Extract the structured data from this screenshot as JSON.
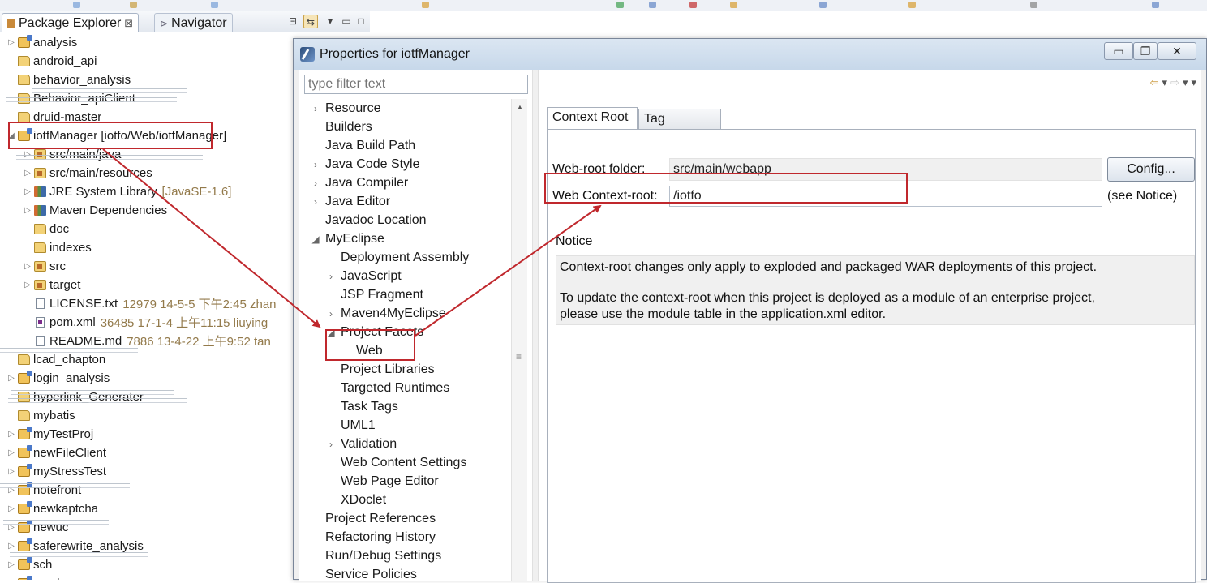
{
  "explorer": {
    "tab_package_explorer": "Package Explorer",
    "tab_navigator": "Navigator",
    "tree": [
      {
        "label": "analysis",
        "icon": "project-icon",
        "expander": "▷"
      },
      {
        "label": "android_api",
        "icon": "folder-icon",
        "expander": ""
      },
      {
        "label": "behavior_analysis",
        "icon": "folder-icon",
        "expander": ""
      },
      {
        "label": "Behavior_apiClient",
        "icon": "folder-icon",
        "expander": ""
      },
      {
        "label": "druid-master",
        "icon": "folder-icon",
        "expander": ""
      },
      {
        "label": "iotfManager [iotfo/Web/iotfManager]",
        "icon": "project-icon",
        "expander": "◢"
      },
      {
        "label": "src/main/java",
        "icon": "package-folder-icon",
        "expander": "▷"
      },
      {
        "label": "src/main/resources",
        "icon": "package-folder-icon",
        "expander": "▷"
      },
      {
        "label": "JRE System Library",
        "decoration": "[JavaSE-1.6]",
        "icon": "library-icon",
        "expander": "▷"
      },
      {
        "label": "Maven Dependencies",
        "icon": "library-icon",
        "expander": "▷"
      },
      {
        "label": "doc",
        "icon": "folder-icon",
        "expander": ""
      },
      {
        "label": "indexes",
        "icon": "folder-icon",
        "expander": ""
      },
      {
        "label": "src",
        "icon": "package-folder-icon",
        "expander": "▷"
      },
      {
        "label": "target",
        "icon": "package-folder-icon",
        "expander": "▷"
      },
      {
        "label": "LICENSE.txt",
        "decoration": "12979  14-5-5 下午2:45  zhan",
        "icon": "file-icon",
        "expander": ""
      },
      {
        "label": "pom.xml",
        "decoration": "36485  17-1-4 上午11:15  liuying",
        "icon": "xml-file-icon",
        "expander": ""
      },
      {
        "label": "README.md",
        "decoration": "7886  13-4-22 上午9:52  tan",
        "icon": "file-icon",
        "expander": ""
      },
      {
        "label": "lcad_chapton",
        "icon": "folder-icon",
        "expander": ""
      },
      {
        "label": "login_analysis",
        "icon": "project-icon",
        "expander": "▷"
      },
      {
        "label": "hyperlink_Generater",
        "icon": "folder-icon",
        "expander": ""
      },
      {
        "label": "mybatis",
        "icon": "folder-icon",
        "expander": ""
      },
      {
        "label": "myTestProj",
        "icon": "project-icon",
        "expander": "▷"
      },
      {
        "label": "newFileClient",
        "icon": "project-icon",
        "expander": "▷"
      },
      {
        "label": "myStressTest",
        "icon": "project-icon",
        "expander": "▷"
      },
      {
        "label": "notefront",
        "icon": "project-icon",
        "expander": "▷"
      },
      {
        "label": "newkaptcha",
        "icon": "project-icon",
        "expander": "▷"
      },
      {
        "label": "newuc",
        "icon": "project-icon",
        "expander": "▷"
      },
      {
        "label": "saferewrite_analysis",
        "icon": "project-icon",
        "expander": "▷"
      },
      {
        "label": "sch",
        "icon": "project-icon",
        "expander": "▷"
      },
      {
        "label": "sendsms",
        "icon": "project-icon",
        "expander": "▷"
      }
    ]
  },
  "dialog": {
    "title": "Properties for iotfManager",
    "window_buttons": {
      "minimize": "▭",
      "maximize": "❐",
      "close": "✕"
    },
    "filter_placeholder": "type filter text",
    "nav": [
      {
        "label": "Resource",
        "expander": "›",
        "level": 0
      },
      {
        "label": "Builders",
        "expander": "",
        "level": 0
      },
      {
        "label": "Java Build Path",
        "expander": "",
        "level": 0
      },
      {
        "label": "Java Code Style",
        "expander": "›",
        "level": 0
      },
      {
        "label": "Java Compiler",
        "expander": "›",
        "level": 0
      },
      {
        "label": "Java Editor",
        "expander": "›",
        "level": 0
      },
      {
        "label": "Javadoc Location",
        "expander": "",
        "level": 0
      },
      {
        "label": "MyEclipse",
        "expander": "◢",
        "level": 0
      },
      {
        "label": "Deployment Assembly",
        "expander": "",
        "level": 1
      },
      {
        "label": "JavaScript",
        "expander": "›",
        "level": 1
      },
      {
        "label": "JSP Fragment",
        "expander": "",
        "level": 1
      },
      {
        "label": "Maven4MyEclipse",
        "expander": "›",
        "level": 1
      },
      {
        "label": "Project Facets",
        "expander": "◢",
        "level": 1
      },
      {
        "label": "Web",
        "expander": "",
        "level": 2
      },
      {
        "label": "Project Libraries",
        "expander": "",
        "level": 1
      },
      {
        "label": "Targeted Runtimes",
        "expander": "",
        "level": 1
      },
      {
        "label": "Task Tags",
        "expander": "",
        "level": 1
      },
      {
        "label": "UML1",
        "expander": "",
        "level": 1
      },
      {
        "label": "Validation",
        "expander": "›",
        "level": 1
      },
      {
        "label": "Web Content Settings",
        "expander": "",
        "level": 1
      },
      {
        "label": "Web Page Editor",
        "expander": "",
        "level": 1
      },
      {
        "label": "XDoclet",
        "expander": "",
        "level": 1
      },
      {
        "label": "Project References",
        "expander": "",
        "level": 0
      },
      {
        "label": "Refactoring History",
        "expander": "",
        "level": 0
      },
      {
        "label": "Run/Debug Settings",
        "expander": "",
        "level": 0
      },
      {
        "label": "Service Policies",
        "expander": "",
        "level": 0
      }
    ],
    "tabs": [
      "Context Root",
      "Tag Libraries"
    ],
    "web_root_label": "Web-root folder:",
    "web_root_value": "src/main/webapp",
    "config_button": "Config...",
    "context_root_label": "Web Context-root:",
    "context_root_value": "/iotfo",
    "see_notice": "(see Notice)",
    "notice_label": "Notice",
    "notice_line1": "Context-root changes only apply to exploded and packaged WAR deployments of this project.",
    "notice_line2": "To update the context-root when this project is deployed as a module of an enterprise project,",
    "notice_line3": "please use the module table in the application.xml editor."
  },
  "colors": {
    "annotation_red": "#c0282d",
    "decoration": "#937a4b",
    "highlight_box": "#f0f0f0"
  }
}
